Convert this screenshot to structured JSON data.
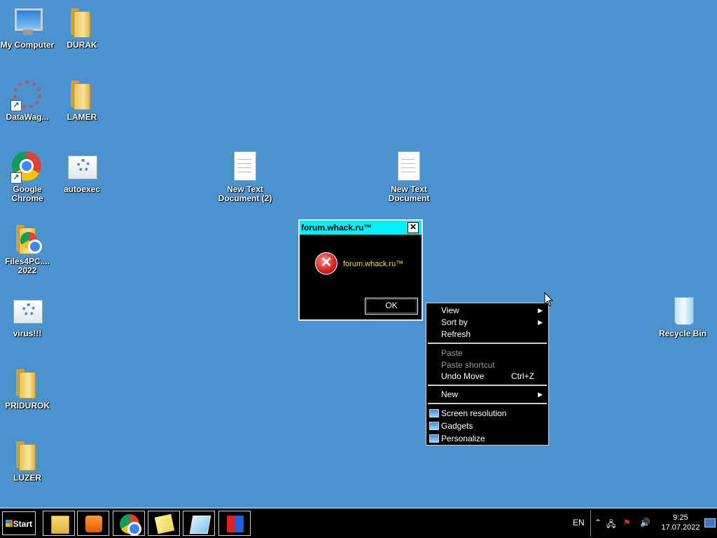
{
  "desktop": {
    "icons": [
      {
        "label": "My Computer",
        "icon": "computer-icon"
      },
      {
        "label": "DURAK",
        "icon": "folder-icon"
      },
      {
        "label": "DataWag...",
        "icon": "app-shortcut-icon"
      },
      {
        "label": "LAMER",
        "icon": "folder-icon"
      },
      {
        "label": "Google Chrome",
        "icon": "chrome-icon"
      },
      {
        "label": "autoexec",
        "icon": "settings-file-icon"
      },
      {
        "label": "New Text Document (2)",
        "icon": "text-document-icon"
      },
      {
        "label": "New Text Document",
        "icon": "text-document-icon"
      },
      {
        "label": "Files4PC.... 2022",
        "icon": "chrome-folder-icon"
      },
      {
        "label": "virus!!!",
        "icon": "settings-file-icon"
      },
      {
        "label": "Recycle Bin",
        "icon": "recycle-bin-icon"
      },
      {
        "label": "PRIDUROK",
        "icon": "folder-icon"
      },
      {
        "label": "LUZER",
        "icon": "folder-icon"
      }
    ]
  },
  "dialog": {
    "title": "forum.whack.ru™",
    "message": "forum.whack.ru™",
    "ok_label": "OK",
    "close_glyph": "✕",
    "title_color": "#00f0ff",
    "message_color": "#ffd94a"
  },
  "context_menu": {
    "view": "View",
    "sort_by": "Sort by",
    "refresh": "Refresh",
    "paste": "Paste",
    "paste_shortcut": "Paste shortcut",
    "undo_move": "Undo Move",
    "undo_shortcut": "Ctrl+Z",
    "new": "New",
    "screen_resolution": "Screen resolution",
    "gadgets": "Gadgets",
    "personalize": "Personalize",
    "submenu_arrow": "▶"
  },
  "taskbar": {
    "start_label": "Start",
    "pinned": [
      "file-explorer-icon",
      "media-player-icon",
      "chrome-icon",
      "sticky-notes-icon",
      "snipping-icon",
      "paint-app-icon"
    ],
    "language": "EN",
    "time": "9:25",
    "date": "17.07.2022"
  },
  "colors": {
    "desktop_background": "#4a93cf",
    "taskbar": "#000000"
  }
}
